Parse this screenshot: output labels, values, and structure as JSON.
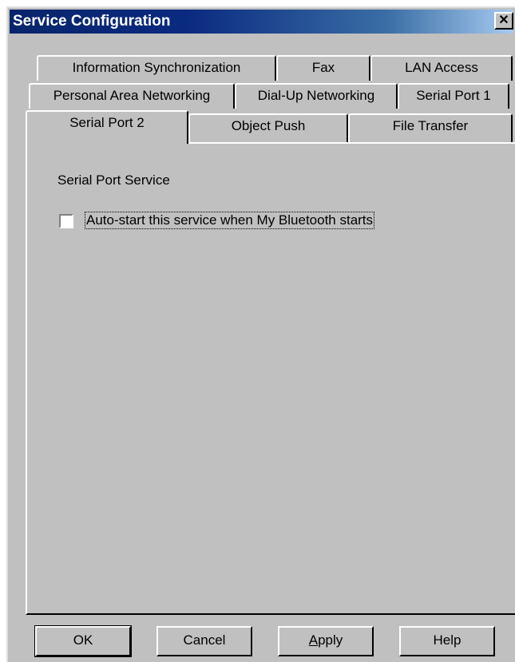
{
  "window": {
    "title": "Service Configuration",
    "close_glyph": "✕"
  },
  "tabs": {
    "row1": [
      "Information Synchronization",
      "Fax",
      "LAN Access"
    ],
    "row2": [
      "Personal Area Networking",
      "Dial-Up Networking",
      "Serial Port 1"
    ],
    "row3": [
      "Serial Port 2",
      "Object Push",
      "File Transfer"
    ],
    "active": "Serial Port 2"
  },
  "panel": {
    "heading": "Serial Port Service",
    "autostart": {
      "label": "Auto-start this service when My Bluetooth starts",
      "checked": false
    }
  },
  "buttons": {
    "ok": "OK",
    "cancel": "Cancel",
    "apply_first": "A",
    "apply_rest": "pply",
    "help": "Help"
  }
}
